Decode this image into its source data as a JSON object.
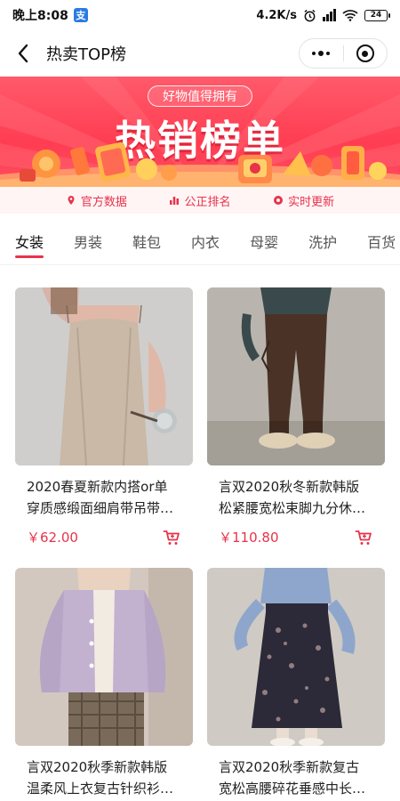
{
  "status_bar": {
    "time": "晚上8:08",
    "app_badge": "支",
    "network_speed": "4.2K/s",
    "signal": "HD",
    "battery": "24"
  },
  "nav": {
    "title": "热卖TOP榜"
  },
  "banner": {
    "tagline": "好物值得拥有",
    "headline": "热销榜单"
  },
  "features": [
    {
      "label": "官方数据",
      "icon": "location-pin-icon"
    },
    {
      "label": "公正排名",
      "icon": "bar-chart-icon"
    },
    {
      "label": "实时更新",
      "icon": "refresh-dot-icon"
    }
  ],
  "tabs": [
    {
      "label": "女装",
      "active": true
    },
    {
      "label": "男装"
    },
    {
      "label": "鞋包"
    },
    {
      "label": "内衣"
    },
    {
      "label": "母婴"
    },
    {
      "label": "洗护"
    },
    {
      "label": "百货"
    }
  ],
  "products": [
    {
      "title_line1": "2020春夏新款内搭or单",
      "title_line2": "穿质感缎面细肩带吊带…",
      "price": "￥62.00",
      "image": "beige-satin-camisole-photo"
    },
    {
      "title_line1": "言双2020秋冬新款韩版",
      "title_line2": "松紧腰宽松束脚九分休…",
      "price": "￥110.80",
      "image": "brown-jogger-pants-photo"
    },
    {
      "title_line1": "言双2020秋季新款韩版",
      "title_line2": "温柔风上衣复古针织衫…",
      "price": "",
      "image": "lilac-knit-cardigan-photo"
    },
    {
      "title_line1": "言双2020秋季新款复古",
      "title_line2": "宽松高腰碎花垂感中长…",
      "price": "",
      "image": "floral-midi-skirt-photo"
    }
  ],
  "colors": {
    "accent": "#e8334a",
    "banner_bg": "#ff4b5f"
  }
}
